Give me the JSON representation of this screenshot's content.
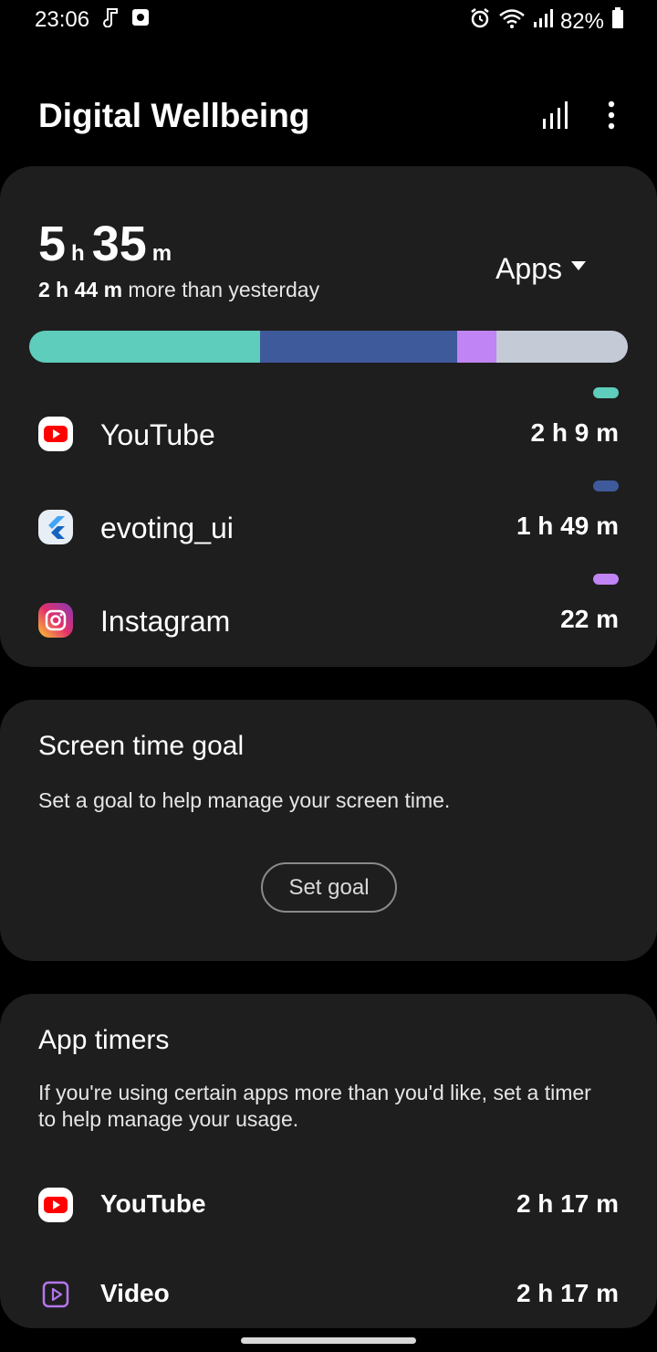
{
  "status_bar": {
    "time": "23:06",
    "battery": "82%",
    "icons": [
      "music-note-icon",
      "square-app-icon",
      "alarm-icon",
      "wifi-icon",
      "signal-icon",
      "battery-icon"
    ]
  },
  "header": {
    "title": "Digital Wellbeing",
    "icons": [
      "bar-chart-icon",
      "more-vert-icon"
    ]
  },
  "usage": {
    "hours": "5",
    "hours_unit": "h",
    "minutes": "35",
    "minutes_unit": "m",
    "compare_bold": "2 h 44 m",
    "compare_rest": " more than yesterday",
    "filter_label": "Apps",
    "bar_segments": [
      {
        "app": "YouTube",
        "fraction": 0.386,
        "color": "#5ecdbb"
      },
      {
        "app": "evoting_ui",
        "fraction": 0.329,
        "color": "#3f5a9b"
      },
      {
        "app": "Instagram",
        "fraction": 0.066,
        "color": "#c084f5"
      },
      {
        "app": "Other",
        "fraction": 0.219,
        "color": "#c4cad6"
      }
    ],
    "apps": [
      {
        "name": "YouTube",
        "time": "2 h 9 m",
        "icon": "youtube-icon",
        "color": "#5ecdbb"
      },
      {
        "name": "evoting_ui",
        "time": "1 h 49 m",
        "icon": "flutter-icon",
        "color": "#3f5a9b"
      },
      {
        "name": "Instagram",
        "time": "22 m",
        "icon": "instagram-icon",
        "color": "#c084f5"
      }
    ]
  },
  "goal": {
    "title": "Screen time goal",
    "description": "Set a goal to help manage your screen time.",
    "button": "Set goal"
  },
  "timers": {
    "title": "App timers",
    "description": "If you're using certain apps more than you'd like, set a timer to help manage your usage.",
    "apps": [
      {
        "name": "YouTube",
        "time": "2 h 17 m",
        "icon": "youtube-icon"
      },
      {
        "name": "Video",
        "time": "2 h 17 m",
        "icon": "video-player-icon"
      }
    ]
  }
}
